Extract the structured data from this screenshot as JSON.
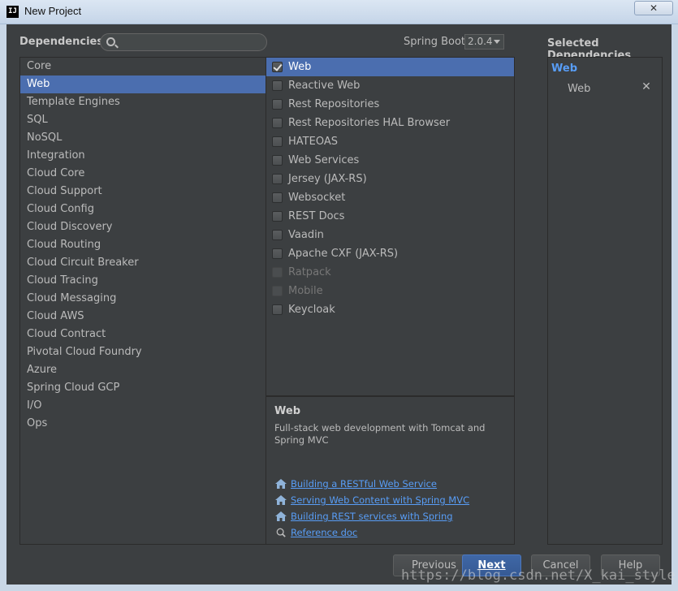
{
  "window": {
    "title": "New Project",
    "close_glyph": "✕"
  },
  "header": {
    "dependencies_label": "Dependencies",
    "search_placeholder": "",
    "spring_boot_label": "Spring Boot",
    "spring_boot_version": "2.0.4",
    "selected_label": "Selected Dependencies"
  },
  "categories": [
    "Core",
    "Web",
    "Template Engines",
    "SQL",
    "NoSQL",
    "Integration",
    "Cloud Core",
    "Cloud Support",
    "Cloud Config",
    "Cloud Discovery",
    "Cloud Routing",
    "Cloud Circuit Breaker",
    "Cloud Tracing",
    "Cloud Messaging",
    "Cloud AWS",
    "Cloud Contract",
    "Pivotal Cloud Foundry",
    "Azure",
    "Spring Cloud GCP",
    "I/O",
    "Ops"
  ],
  "selected_category": "Web",
  "dependencies": [
    {
      "label": "Web",
      "checked": true,
      "disabled": false,
      "selected": true
    },
    {
      "label": "Reactive Web",
      "checked": false,
      "disabled": false,
      "selected": false
    },
    {
      "label": "Rest Repositories",
      "checked": false,
      "disabled": false,
      "selected": false
    },
    {
      "label": "Rest Repositories HAL Browser",
      "checked": false,
      "disabled": false,
      "selected": false
    },
    {
      "label": "HATEOAS",
      "checked": false,
      "disabled": false,
      "selected": false
    },
    {
      "label": "Web Services",
      "checked": false,
      "disabled": false,
      "selected": false
    },
    {
      "label": "Jersey (JAX-RS)",
      "checked": false,
      "disabled": false,
      "selected": false
    },
    {
      "label": "Websocket",
      "checked": false,
      "disabled": false,
      "selected": false
    },
    {
      "label": "REST Docs",
      "checked": false,
      "disabled": false,
      "selected": false
    },
    {
      "label": "Vaadin",
      "checked": false,
      "disabled": false,
      "selected": false
    },
    {
      "label": "Apache CXF (JAX-RS)",
      "checked": false,
      "disabled": false,
      "selected": false
    },
    {
      "label": "Ratpack",
      "checked": false,
      "disabled": true,
      "selected": false
    },
    {
      "label": "Mobile",
      "checked": false,
      "disabled": true,
      "selected": false
    },
    {
      "label": "Keycloak",
      "checked": false,
      "disabled": false,
      "selected": false
    }
  ],
  "description": {
    "title": "Web",
    "text": "Full-stack web development with Tomcat and Spring MVC",
    "links": [
      {
        "label": "Building a RESTful Web Service",
        "icon": "home-icon"
      },
      {
        "label": "Serving Web Content with Spring MVC",
        "icon": "home-icon"
      },
      {
        "label": "Building REST services with Spring",
        "icon": "home-icon"
      },
      {
        "label": "Reference doc",
        "icon": "docs-search-icon"
      }
    ]
  },
  "selected_dependencies": {
    "group": "Web",
    "items": [
      {
        "label": "Web",
        "remove_glyph": "✕"
      }
    ]
  },
  "buttons": {
    "previous": "Previous",
    "next": "Next",
    "cancel": "Cancel",
    "help": "Help"
  },
  "watermark": "https://blog.csdn.net/X_kai_style",
  "colors": {
    "selection": "#4b6eaf",
    "link": "#589df6",
    "background": "#3c3f41"
  }
}
